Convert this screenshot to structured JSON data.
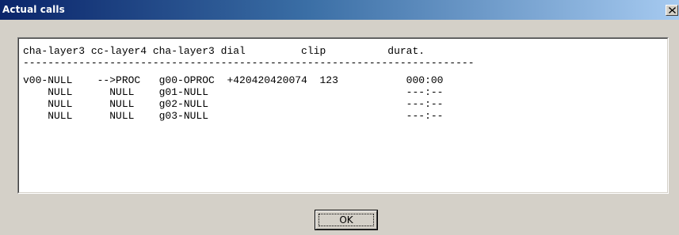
{
  "window": {
    "title": "Actual calls"
  },
  "close_button": {
    "icon": "close-icon"
  },
  "listing": {
    "header": "cha-layer3 cc-layer4 cha-layer3 dial         clip          durat.",
    "separator": "-------------------------------------------------------------------------",
    "rows": [
      "v00-NULL    -->PROC   g00-OPROC  +420420420074  123           000:00",
      "    NULL      NULL    g01-NULL                                ---:--",
      "    NULL      NULL    g02-NULL                                ---:--",
      "    NULL      NULL    g03-NULL                                ---:--"
    ]
  },
  "buttons": {
    "ok_label": "OK"
  }
}
